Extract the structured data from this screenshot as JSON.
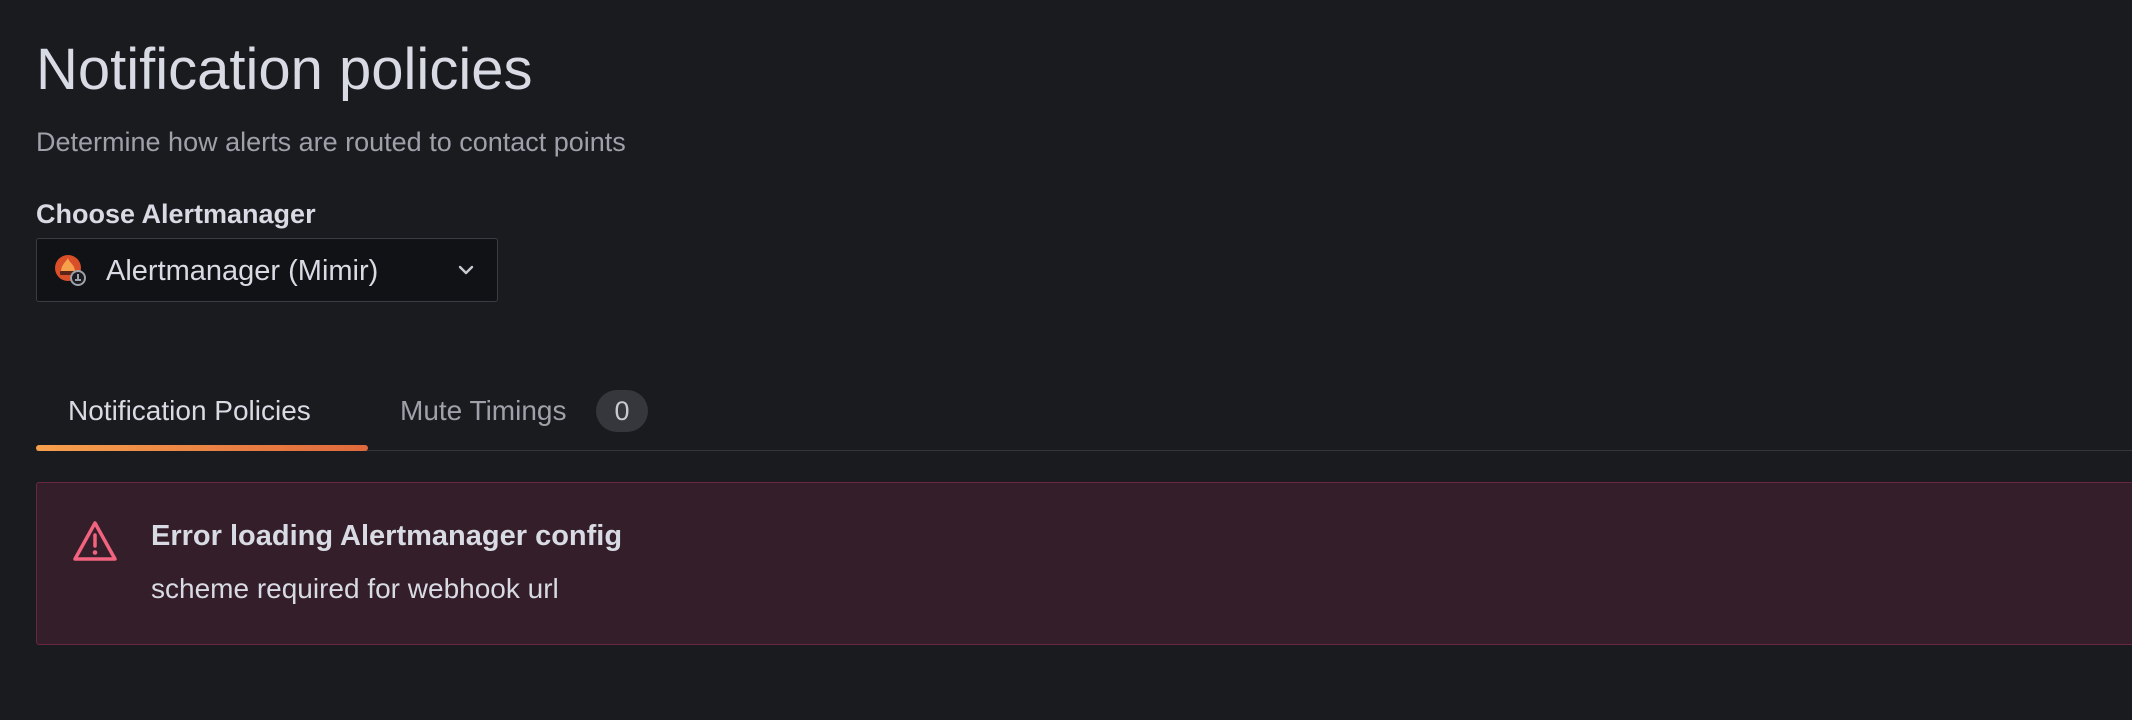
{
  "header": {
    "title": "Notification policies",
    "subtitle": "Determine how alerts are routed to contact points"
  },
  "alertmanager_picker": {
    "label": "Choose Alertmanager",
    "selected_value": "Alertmanager (Mimir)",
    "logo_icon": "mimir-alertmanager-logo-icon",
    "dropdown_icon": "chevron-down-icon"
  },
  "tabs": [
    {
      "label": "Notification Policies",
      "active": true
    },
    {
      "label": "Mute Timings",
      "active": false,
      "counter": "0"
    }
  ],
  "error_alert": {
    "icon": "exclamation-triangle-icon",
    "title": "Error loading Alertmanager config",
    "message": "scheme required for webhook url"
  },
  "colors": {
    "background": "#1a1b1f",
    "active_tab_underline": "#f17a3f",
    "error_icon": "#f2637f",
    "error_background": "#331e29",
    "error_border": "#6b2740"
  }
}
